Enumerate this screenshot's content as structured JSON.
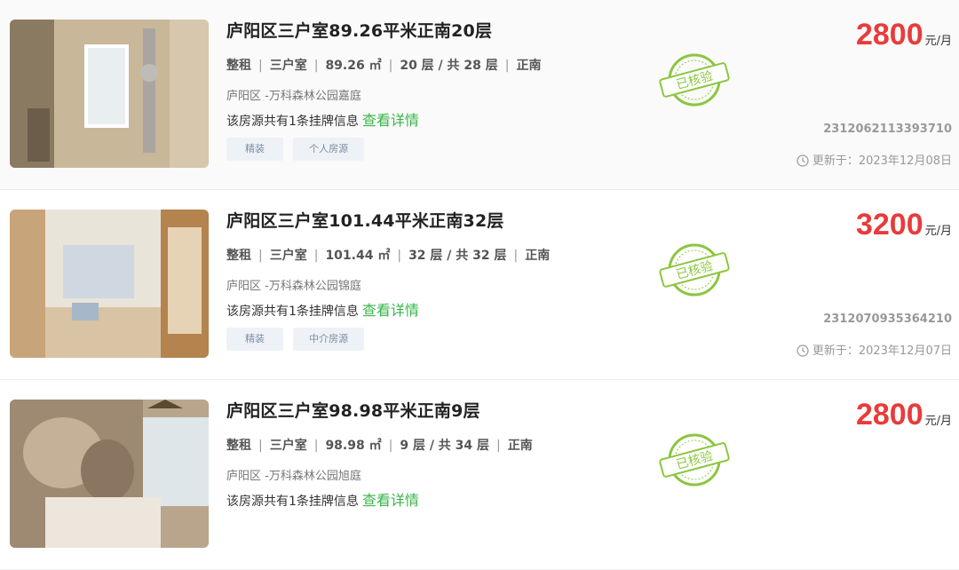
{
  "listings": [
    {
      "title": "庐阳区三户室89.26平米正南20层",
      "type": "整租",
      "layout": "三户室",
      "area": "89.26 ㎡",
      "floor": "20 层 / 共 28 层",
      "orientation": "正南",
      "community": "庐阳区 -万科森林公园嘉庭",
      "listing_info": "该房源共有1条挂牌信息",
      "detail_link": "查看详情",
      "tags": [
        "精装",
        "个人房源"
      ],
      "stamp_text": "已核验",
      "price": "2800",
      "price_unit": "元/月",
      "code": "2312062113393710",
      "updated": "更新于：2023年12月08日"
    },
    {
      "title": "庐阳区三户室101.44平米正南32层",
      "type": "整租",
      "layout": "三户室",
      "area": "101.44 ㎡",
      "floor": "32 层 / 共 32 层",
      "orientation": "正南",
      "community": "庐阳区 -万科森林公园锦庭",
      "listing_info": "该房源共有1条挂牌信息",
      "detail_link": "查看详情",
      "tags": [
        "精装",
        "中介房源"
      ],
      "stamp_text": "已核验",
      "price": "3200",
      "price_unit": "元/月",
      "code": "2312070935364210",
      "updated": "更新于：2023年12月07日"
    },
    {
      "title": "庐阳区三户室98.98平米正南9层",
      "type": "整租",
      "layout": "三户室",
      "area": "98.98 ㎡",
      "floor": "9 层 / 共 34 层",
      "orientation": "正南",
      "community": "庐阳区 -万科森林公园旭庭",
      "listing_info": "该房源共有1条挂牌信息",
      "detail_link": "查看详情",
      "tags": [],
      "stamp_text": "已核验",
      "price": "2800",
      "price_unit": "元/月",
      "code": "",
      "updated": ""
    }
  ],
  "colors": {
    "price": "#e93b3b",
    "link": "#39b54a",
    "stamp": "#8cc63f",
    "tag_bg": "#eef2f7",
    "tag_text": "#7d8ea5"
  },
  "icons": {
    "stamp": "verified-stamp-icon",
    "clock": "clock-icon"
  }
}
